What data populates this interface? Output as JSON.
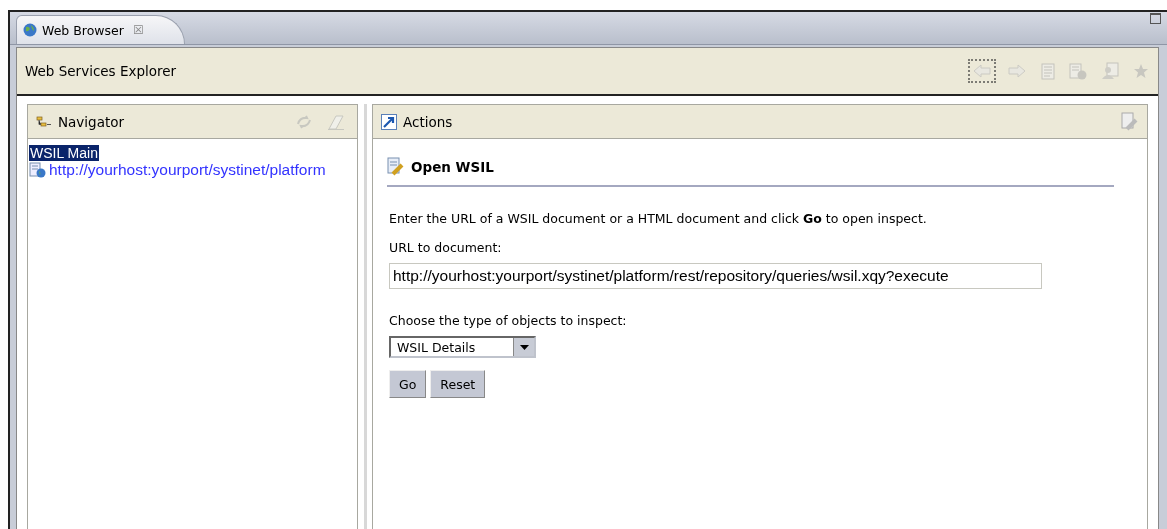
{
  "tab": {
    "title": "Web Browser",
    "close": "☒"
  },
  "explorer": {
    "title": "Web Services Explorer",
    "toolbar": [
      {
        "kind": "back",
        "disabled": true,
        "focused": true
      },
      {
        "kind": "forward",
        "disabled": true,
        "focused": false
      },
      {
        "kind": "document",
        "disabled": true,
        "focused": false
      },
      {
        "kind": "document-globe",
        "disabled": true,
        "focused": false
      },
      {
        "kind": "person",
        "disabled": true,
        "focused": false
      },
      {
        "kind": "star",
        "disabled": true,
        "focused": false
      }
    ]
  },
  "navigator": {
    "title": "Navigator",
    "items": [
      {
        "label": "WSIL Main",
        "kind": "root",
        "selected": true
      },
      {
        "label": "http://yourhost:yourport/systinet/platform",
        "kind": "link",
        "selected": false
      }
    ]
  },
  "actions": {
    "title": "Actions",
    "heading": "Open WSIL",
    "intro": "Enter the URL of a WSIL document or a HTML document and click **Go** to open inspect.",
    "url_label": "URL to document:",
    "url_value": "http://yourhost:yourport/systinet/platform/rest/repository/queries/wsil.xqy?execute",
    "type_label": "Choose the type of objects to inspect:",
    "type_value": "WSIL Details",
    "buttons": [
      "Go",
      "Reset"
    ]
  }
}
